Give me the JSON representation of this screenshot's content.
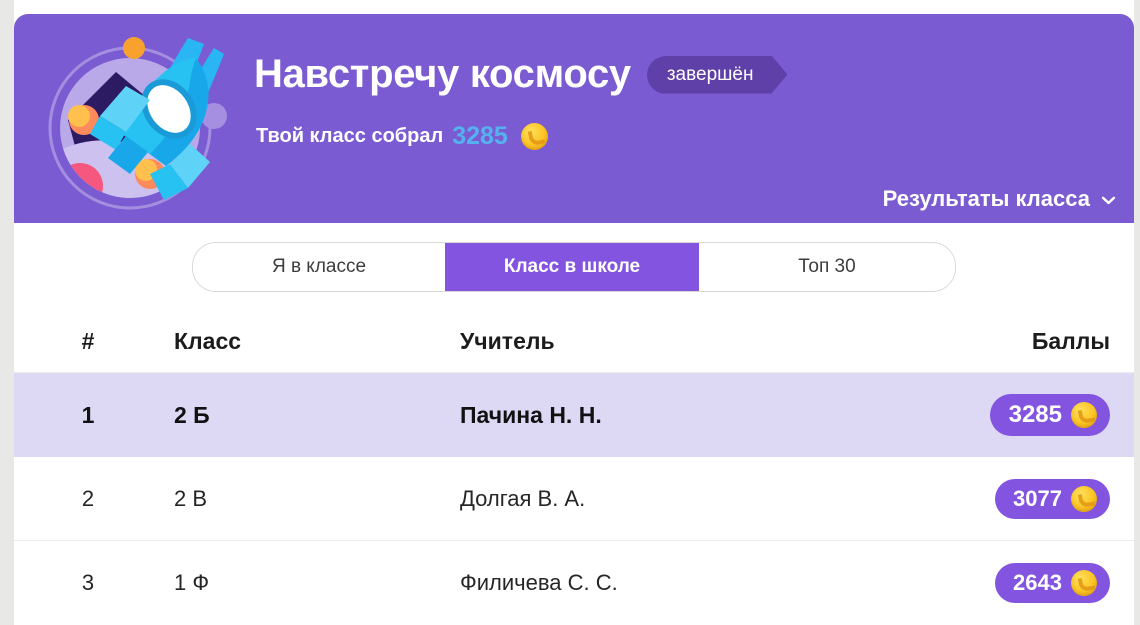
{
  "hero": {
    "illustration_name": "rocket-in-circle-illustration",
    "title": "Навстречу космосу",
    "status_badge": "завершён",
    "subtitle_prefix": "Твой класс собрал",
    "subtitle_score": "3285",
    "coin_icon": "coin-icon",
    "results_link": "Результаты класса",
    "chevron_icon": "chevron-down-icon",
    "bg_color": "#7b5bd1",
    "badge_color": "#5f3fa8",
    "score_color": "#55b2ee"
  },
  "tabs": [
    {
      "label": "Я в классе",
      "active": false
    },
    {
      "label": "Класс в школе",
      "active": true
    },
    {
      "label": "Топ 30",
      "active": false
    }
  ],
  "table": {
    "columns": [
      "#",
      "Класс",
      "Учитель",
      "Баллы"
    ],
    "rows": [
      {
        "rank": "1",
        "class": "2 Б",
        "teacher": "Пачина Н. Н.",
        "score": "3285",
        "highlighted": true
      },
      {
        "rank": "2",
        "class": "2 В",
        "teacher": "Долгая В. А.",
        "score": "3077",
        "highlighted": false
      },
      {
        "rank": "3",
        "class": "1 Ф",
        "teacher": "Филичева С. С.",
        "score": "2643",
        "highlighted": false
      }
    ]
  },
  "colors": {
    "accent_purple": "#8254e0",
    "hero_purple": "#7b5bd1",
    "highlight_row": "#ddd8f4",
    "page_bg": "#e8e8e6"
  }
}
